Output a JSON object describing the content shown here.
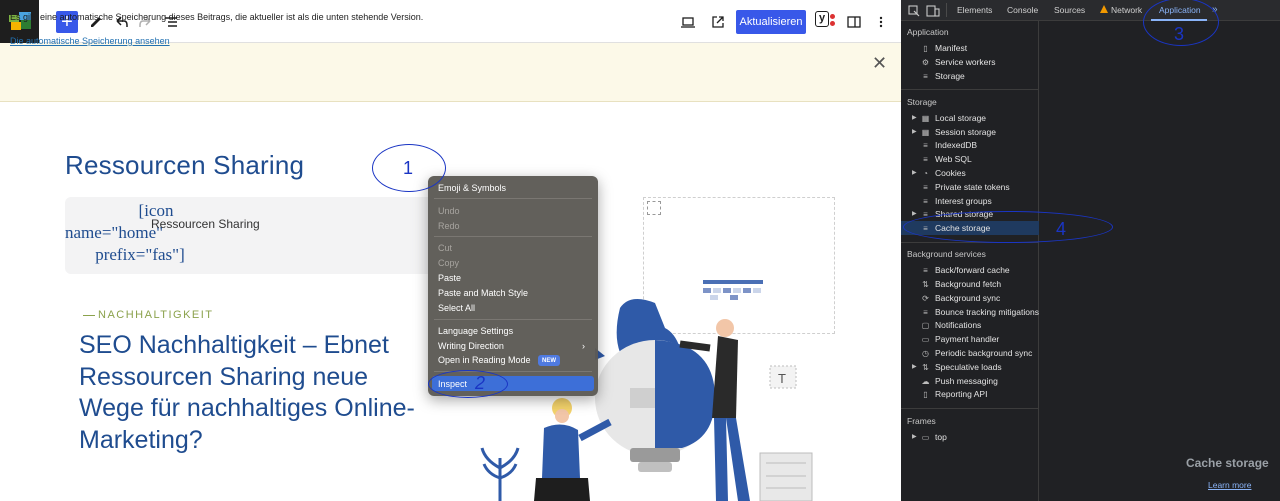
{
  "toolbar": {
    "update_label": "Aktualisieren",
    "yoast_label": "y"
  },
  "notice": {
    "text": "Es gibt eine automatische Speicherung dieses Beitrags, die aktueller ist als die unten stehende Version.",
    "link": "Die automatische Speicherung ansehen"
  },
  "editor": {
    "title": "Ressourcen Sharing",
    "shortcode_lines": [
      "[icon",
      "name=\"home\"",
      "prefix=\"fas\"]"
    ],
    "block_label": "Ressourcen Sharing",
    "kicker": "NACHHALTIGKEIT",
    "headline": "SEO Nachhaltigkeit – Ebnet Ressourcen Sharing neue Wege für nachhaltiges Online-Marketing?"
  },
  "context_menu": {
    "items": [
      {
        "label": "Emoji & Symbols",
        "disabled": false
      },
      {
        "label": "Undo",
        "disabled": true
      },
      {
        "label": "Redo",
        "disabled": true
      },
      {
        "label": "Cut",
        "disabled": true
      },
      {
        "label": "Copy",
        "disabled": true
      },
      {
        "label": "Paste",
        "disabled": false
      },
      {
        "label": "Paste and Match Style",
        "disabled": false
      },
      {
        "label": "Select All",
        "disabled": false
      },
      {
        "label": "Language Settings",
        "disabled": false
      },
      {
        "label": "Writing Direction",
        "disabled": false
      },
      {
        "label": "Open in Reading Mode",
        "disabled": false
      },
      {
        "label": "Inspect",
        "disabled": false
      }
    ],
    "new_badge": "NEW"
  },
  "annotations": [
    "1",
    "2",
    "3",
    "4"
  ],
  "devtools": {
    "tabs": [
      "Elements",
      "Console",
      "Sources",
      "Network",
      "Application"
    ],
    "active_tab": "Application",
    "sections": {
      "application": {
        "title": "Application",
        "items": [
          "Manifest",
          "Service workers",
          "Storage"
        ]
      },
      "storage": {
        "title": "Storage",
        "items": [
          "Local storage",
          "Session storage",
          "IndexedDB",
          "Web SQL",
          "Cookies",
          "Private state tokens",
          "Interest groups",
          "Shared storage",
          "Cache storage"
        ]
      },
      "background": {
        "title": "Background services",
        "items": [
          "Back/forward cache",
          "Background fetch",
          "Background sync",
          "Bounce tracking mitigations",
          "Notifications",
          "Payment handler",
          "Periodic background sync",
          "Speculative loads",
          "Push messaging",
          "Reporting API"
        ]
      },
      "frames": {
        "title": "Frames",
        "items": [
          "top"
        ]
      }
    },
    "selected_item": "Cache storage",
    "main_title": "Cache storage",
    "learn_more": "Learn more"
  }
}
